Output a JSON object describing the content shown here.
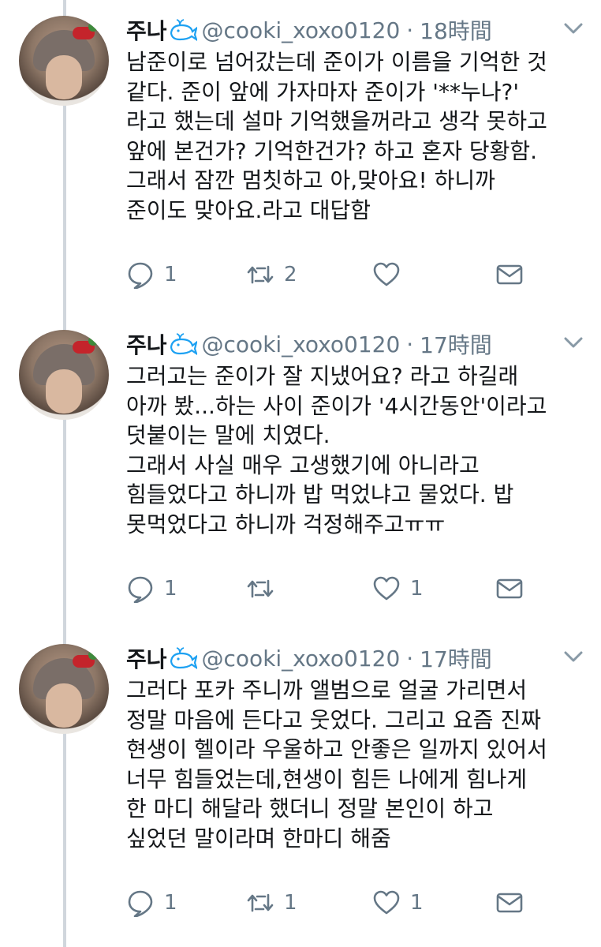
{
  "tweets": [
    {
      "name": "주나",
      "handle": "@cooki_xoxo0120",
      "separator": "·",
      "time": "18時間",
      "text": "남준이로 넘어갔는데 준이가 이름을 기억한 것\n같다. 준이 앞에 가자마자 준이가 '**누나?'\n라고 했는데 설마 기억했을꺼라고 생각 못하고\n앞에 본건가? 기억한건가? 하고 혼자 당황함.\n그래서 잠깐 멈칫하고 아,맞아요! 하니까\n준이도 맞아요.라고 대답함",
      "reply_count": "1",
      "retweet_count": "2",
      "like_count": ""
    },
    {
      "name": "주나",
      "handle": "@cooki_xoxo0120",
      "separator": "·",
      "time": "17時間",
      "text": "그러고는 준이가 잘 지냈어요? 라고 하길래\n아까 봤...하는 사이 준이가 '4시간동안'이라고\n덧붙이는 말에 치였다.\n그래서 사실 매우 고생했기에 아니라고\n힘들었다고 하니까 밥 먹었냐고 물었다. 밥\n못먹었다고 하니까 걱정해주고ㅠㅠ",
      "reply_count": "1",
      "retweet_count": "",
      "like_count": "1"
    },
    {
      "name": "주나",
      "handle": "@cooki_xoxo0120",
      "separator": "·",
      "time": "17時間",
      "text": "그러다 포카 주니까 앨범으로 얼굴 가리면서\n정말 마음에 든다고 웃었다. 그리고 요즘 진짜\n현생이 헬이라 우울하고 안좋은 일까지 있어서\n너무 힘들었는데,현생이 힘든 나에게 힘나게\n한 마디 해달라 했더니 정말 본인이 하고\n싶었던 말이라며 한마디 해줌",
      "reply_count": "1",
      "retweet_count": "1",
      "like_count": "1"
    }
  ],
  "colors": {
    "text": "#14171a",
    "secondary": "#657786",
    "whale": "#1da1f2",
    "thread_line": "#d0d6dc"
  }
}
